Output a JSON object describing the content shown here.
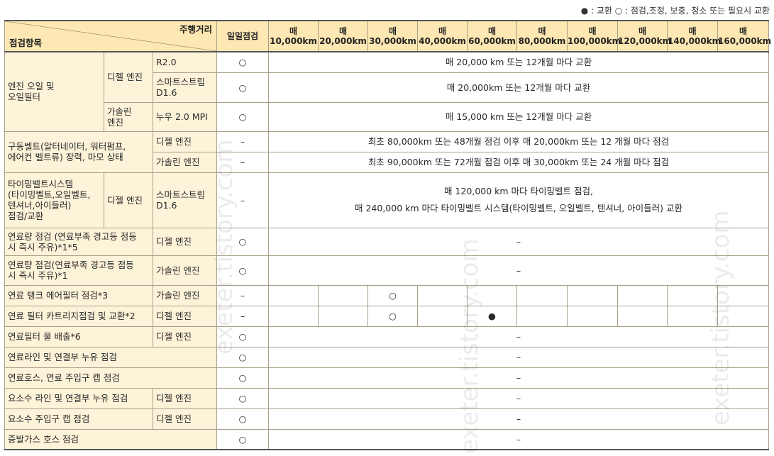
{
  "legend": "● : 교환 ○ : 점검,조정, 보충, 청소 또는 필요시 교환",
  "header": {
    "corner_top": "주행거리",
    "corner_bottom": "점검항목",
    "daily": "일일점검",
    "intervals": [
      {
        "top": "매",
        "bottom": "10,000km"
      },
      {
        "top": "매",
        "bottom": "20,000km"
      },
      {
        "top": "매",
        "bottom": "30,000km"
      },
      {
        "top": "매",
        "bottom": "40,000km"
      },
      {
        "top": "매",
        "bottom": "60,000km"
      },
      {
        "top": "매",
        "bottom": "80,000km"
      },
      {
        "top": "매",
        "bottom": "100,000km"
      },
      {
        "top": "매",
        "bottom": "120,000km"
      },
      {
        "top": "매",
        "bottom": "140,000km"
      },
      {
        "top": "매",
        "bottom": "160,000km"
      }
    ]
  },
  "rows": {
    "oil": {
      "item": "엔진 오일 및\n오일필터",
      "diesel": "디젤 엔진",
      "gasoline": "가솔린\n엔진",
      "r20": "R2.0",
      "r20_daily": "○",
      "r20_text": "매 20,000 km 또는 12개월 마다 교환",
      "d16": "스마트스트림\nD1.6",
      "d16_daily": "○",
      "d16_text": "매 20,000km 또는 12개월 마다 교환",
      "mpi": "누우 2.0 MPI",
      "mpi_daily": "○",
      "mpi_text": "매 15,000 km 또는 12개월 마다 교환"
    },
    "belt": {
      "item": "구동벨트(알터네이터, 워터펌프,\n에어컨 벨트류) 장력, 마모 상태",
      "diesel": "디젤 엔진",
      "diesel_daily": "–",
      "diesel_text": "최초 80,000km 또는 48개월 점검 이후 매 20,000km 또는 12 개월 마다 점검",
      "gasoline": "가솔린 엔진",
      "gasoline_daily": "–",
      "gasoline_text": "최초 90,000km 또는 72개월 점검 이후 매 30,000km 또는 24 개월 마다 점검"
    },
    "timing": {
      "item": "타이밍벨트시스템\n(타이밍벨트,오일벨트,\n텐셔너,아이들러)\n점검/교환",
      "engine": "디젤 엔진",
      "spec": "스마트스트림\nD1.6",
      "daily": "–",
      "text": "매 120,000 km 마다 타이밍벨트 점검,\n매 240,000 km 마다 타이밍벨트 시스템(타이밍벨트, 오일벨트, 텐셔너, 아이들러) 교환"
    },
    "fuel_d": {
      "item": "연료량 점검 (연료부족 경고등 점등\n시 즉시 주유)*1*5",
      "engine": "디젤 엔진",
      "daily": "○",
      "text": "–"
    },
    "fuel_g": {
      "item": "연료량 점검(연료부족 경고등 점등\n시 즉시 주유)*1",
      "engine": "가솔린 엔진",
      "daily": "○",
      "text": "–"
    },
    "tank": {
      "item": "연료 탱크 에어필터 점검*3",
      "engine": "가솔린 엔진",
      "daily": "–",
      "marks": [
        "",
        "",
        "○",
        "",
        "",
        "",
        "",
        "",
        "",
        ""
      ]
    },
    "filter": {
      "item": "연료 필터 카트리지점검 및 교환*2",
      "engine": "디젤 엔진",
      "daily": "–",
      "marks": [
        "",
        "",
        "○",
        "",
        "●",
        "",
        "",
        "",
        "",
        ""
      ]
    },
    "drain": {
      "item": "연료필터 물 배출*6",
      "engine": "디젤 엔진",
      "daily": "○",
      "text": "–"
    },
    "line": {
      "item": "연료라인 및 연결부 누유 점검",
      "daily": "○",
      "text": "–"
    },
    "hose": {
      "item": "연료호스, 연료 주입구 캡 점검",
      "daily": "○",
      "text": "–"
    },
    "urea_line": {
      "item": "요소수 라인 및 연결부 누유 점검",
      "engine": "디젤 엔진",
      "daily": "○",
      "text": "–"
    },
    "urea_cap": {
      "item": "요소수 주입구 캡 점검",
      "engine": "디젤 엔진",
      "daily": "○",
      "text": "–"
    },
    "evap": {
      "item": "증발가스 호스 점검",
      "daily": "○",
      "text": "–"
    }
  },
  "watermark": "exeter.tistory.com"
}
